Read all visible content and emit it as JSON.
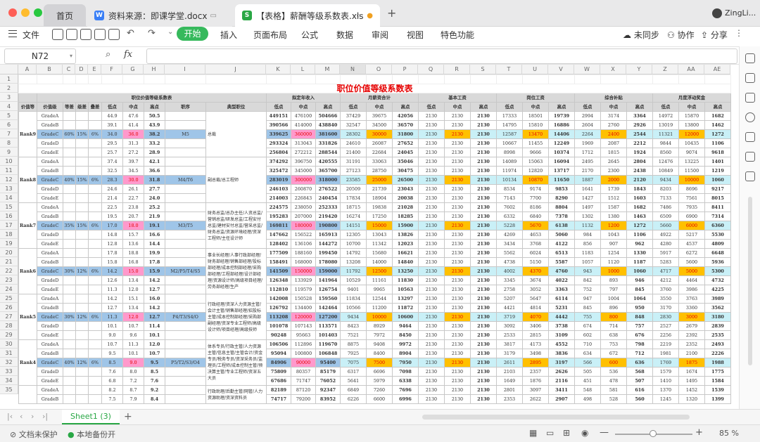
{
  "window": {
    "tabs": [
      {
        "label": "首页"
      },
      {
        "label": "资料来源：即课学堂.docx",
        "badge": "W"
      },
      {
        "label": "【表格】薪酬等级系数表.xls",
        "badge": "S"
      }
    ],
    "new_tab": "+",
    "user": "ZingLi..."
  },
  "menu": {
    "file": "文件",
    "start": "开始",
    "items": [
      "插入",
      "页面布局",
      "公式",
      "数据",
      "审阅",
      "视图",
      "特色功能"
    ],
    "sync": "未同步",
    "collab": "协作",
    "share": "分享"
  },
  "formula": {
    "cell_ref": "N72",
    "fx": "fx",
    "zoom_icon": "magnifier-icon",
    "value": ""
  },
  "sheet": {
    "columns": [
      "A",
      "B",
      "C",
      "D",
      "E",
      "F",
      "G",
      "H",
      "I",
      "J",
      "K",
      "L",
      "M",
      "N",
      "O",
      "P",
      "Q",
      "R",
      "S",
      "T",
      "U",
      "V",
      "W",
      "X",
      "Y",
      "Z",
      "AA",
      "AE"
    ],
    "row_numbers": [
      "1",
      "2",
      "3",
      "4",
      "5",
      "6",
      "7",
      "8",
      "9",
      "10",
      "11",
      "12",
      "13",
      "14",
      "15",
      "16",
      "17",
      "18",
      "19",
      "20",
      "21",
      "22",
      "23",
      "24",
      "25",
      "26",
      "27",
      "28",
      "29",
      "30",
      "31",
      "32",
      "33",
      "34",
      "35"
    ],
    "title": "职位价值等级系数表",
    "section_headers": [
      "职位价值等级系数表",
      "拟定年收入",
      "月薪资合计",
      "基本工资",
      "岗位工资",
      "综合补贴",
      "月度浮动奖金"
    ],
    "sub_headers": [
      "价值等",
      "价值级",
      "等差",
      "级差",
      "叠差",
      "低点",
      "中点",
      "高点",
      "职序",
      "典型职位",
      "低点",
      "中点",
      "高点",
      "低点",
      "中点",
      "高点",
      "低点",
      "中点",
      "高点",
      "低点",
      "中点",
      "高点",
      "低点",
      "中点",
      "高点",
      "低点",
      "中点",
      "高点"
    ],
    "rank_groups": [
      {
        "rank": "Rank9",
        "ratios": [
          "60%",
          "15%",
          "6%"
        ],
        "job": "M5",
        "typical": "总裁",
        "rows": [
          [
            "GradeA",
            "44.9",
            "47.6",
            "50.5",
            "449151",
            "476100",
            "504666",
            "37429",
            "39675",
            "42056",
            "2130",
            "2130",
            "2130",
            "17333",
            "18501",
            "19739",
            "2994",
            "3174",
            "3364",
            "14972",
            "15870",
            "1682"
          ],
          [
            "GradeB",
            "39.1",
            "41.4",
            "43.9",
            "390566",
            "414000",
            "438840",
            "32547",
            "34500",
            "36570",
            "2130",
            "2130",
            "2130",
            "14795",
            "15810",
            "16886",
            "2604",
            "2760",
            "2926",
            "13019",
            "13800",
            "1462"
          ],
          [
            "GradeC",
            "34.0",
            "36.0",
            "38.2",
            "339625",
            "360000",
            "381600",
            "28302",
            "30000",
            "31800",
            "2130",
            "2130",
            "2130",
            "12587",
            "13470",
            "14406",
            "2264",
            "2400",
            "2544",
            "11321",
            "12000",
            "1272"
          ],
          [
            "GradeD",
            "29.5",
            "31.3",
            "33.2",
            "293324",
            "313043",
            "331826",
            "24610",
            "26087",
            "27652",
            "2130",
            "2130",
            "2130",
            "10667",
            "11455",
            "12249",
            "1969",
            "2087",
            "2212",
            "9844",
            "10435",
            "1106"
          ],
          [
            "GradeE",
            "25.7",
            "27.2",
            "28.9",
            "256804",
            "272212",
            "288544",
            "21400",
            "22684",
            "24045",
            "2130",
            "2130",
            "2130",
            "8998",
            "9666",
            "10374",
            "1712",
            "1815",
            "1924",
            "8560",
            "9074",
            "9618"
          ]
        ]
      },
      {
        "rank": "Rank8",
        "ratios": [
          "40%",
          "15%",
          "6%"
        ],
        "job": "M4/T6",
        "typical": "副总裁/总工程师",
        "rows": [
          [
            "GradeA",
            "37.4",
            "39.7",
            "42.1",
            "374292",
            "396750",
            "420555",
            "31191",
            "33063",
            "35046",
            "2130",
            "2130",
            "2130",
            "14089",
            "15063",
            "16094",
            "2495",
            "2645",
            "2804",
            "12476",
            "13225",
            "1401"
          ],
          [
            "GradeB",
            "32.5",
            "34.5",
            "36.6",
            "325472",
            "345000",
            "365700",
            "27123",
            "28750",
            "30475",
            "2130",
            "2130",
            "2130",
            "11974",
            "12820",
            "13717",
            "2170",
            "2300",
            "2438",
            "10849",
            "11500",
            "1219"
          ],
          [
            "GradeC",
            "28.3",
            "30.0",
            "31.8",
            "283019",
            "300000",
            "318000",
            "23585",
            "25000",
            "26500",
            "2130",
            "2130",
            "2130",
            "10134",
            "10870",
            "11650",
            "1887",
            "2000",
            "2120",
            "9434",
            "10000",
            "1060"
          ],
          [
            "GradeD",
            "24.6",
            "26.1",
            "27.7",
            "246103",
            "260870",
            "276522",
            "20509",
            "21739",
            "23043",
            "2130",
            "2130",
            "2130",
            "8534",
            "9174",
            "9853",
            "1641",
            "1739",
            "1843",
            "8203",
            "8696",
            "9217"
          ],
          [
            "GradeE",
            "21.4",
            "22.7",
            "24.0",
            "214003",
            "226843",
            "240454",
            "17834",
            "18904",
            "20038",
            "2130",
            "2130",
            "2130",
            "7143",
            "7700",
            "8290",
            "1427",
            "1512",
            "1603",
            "7133",
            "7561",
            "8015"
          ]
        ]
      },
      {
        "rank": "Rank7",
        "ratios": [
          "35%",
          "15%",
          "6%"
        ],
        "job": "M3/T5",
        "typical": "财务总监/总办主任/人资总监/营销总监/研发总监/工程安付总监/建材安付总监/营采总监/财务总监/资源环境经理/资深工程师/主任设计师",
        "rows": [
          [
            "GradeA",
            "22.5",
            "23.8",
            "25.2",
            "224575",
            "238050",
            "252333",
            "18715",
            "19838",
            "21028",
            "2130",
            "2130",
            "2130",
            "7602",
            "8186",
            "8804",
            "1497",
            "1587",
            "1682",
            "7486",
            "7935",
            "8411"
          ],
          [
            "GradeB",
            "19.5",
            "20.7",
            "21.9",
            "195283",
            "207000",
            "219420",
            "16274",
            "17250",
            "18285",
            "2130",
            "2130",
            "2130",
            "6332",
            "6840",
            "7378",
            "1302",
            "1380",
            "1463",
            "6509",
            "6900",
            "7314"
          ],
          [
            "GradeC",
            "17.0",
            "18.0",
            "19.1",
            "169811",
            "180000",
            "190800",
            "14151",
            "15000",
            "15900",
            "2130",
            "2130",
            "2130",
            "5228",
            "5670",
            "6138",
            "1132",
            "1200",
            "1272",
            "5660",
            "6000",
            "6360"
          ],
          [
            "GradeD",
            "14.8",
            "15.7",
            "16.6",
            "147662",
            "156522",
            "165913",
            "12305",
            "13043",
            "13826",
            "2130",
            "2130",
            "2130",
            "4269",
            "4653",
            "5060",
            "984",
            "1043",
            "1106",
            "4922",
            "5217",
            "5530"
          ],
          [
            "GradeE",
            "12.8",
            "13.6",
            "14.4",
            "128402",
            "136106",
            "144272",
            "10700",
            "11342",
            "12023",
            "2130",
            "2130",
            "2130",
            "3434",
            "3768",
            "4122",
            "856",
            "907",
            "962",
            "4280",
            "4537",
            "4809"
          ]
        ]
      },
      {
        "rank": "Rank6",
        "ratios": [
          "30%",
          "12%",
          "6%"
        ],
        "job": "M2/P5/T4/S5",
        "typical": "事业长经理/人事行政部经理/财务部经理/销售部经理/投标部经理/成本控制部经理/采购部经理/工程部经理/设计部经理/资源设计师/高级项目经理/劳务部经理/生产",
        "rows": [
          [
            "GradeA",
            "17.8",
            "18.8",
            "19.9",
            "177509",
            "188160",
            "199450",
            "14792",
            "15680",
            "16621",
            "2130",
            "2130",
            "2130",
            "5562",
            "6024",
            "6513",
            "1183",
            "1254",
            "1330",
            "5917",
            "6272",
            "6648"
          ],
          [
            "GradeB",
            "15.8",
            "16.8",
            "17.8",
            "158491",
            "168000",
            "178080",
            "13208",
            "14000",
            "14840",
            "2130",
            "2130",
            "2130",
            "4738",
            "5150",
            "5587",
            "1057",
            "1120",
            "1187",
            "5283",
            "5600",
            "5936"
          ],
          [
            "GradeC",
            "14.2",
            "15.0",
            "15.9",
            "141509",
            "150000",
            "159000",
            "11792",
            "12500",
            "13250",
            "2130",
            "2130",
            "2130",
            "4002",
            "4370",
            "4760",
            "943",
            "1000",
            "1060",
            "4717",
            "5000",
            "5300"
          ],
          [
            "GradeD",
            "12.6",
            "13.4",
            "14.2",
            "126348",
            "133929",
            "141964",
            "10529",
            "11161",
            "11830",
            "2130",
            "2130",
            "2130",
            "3345",
            "3674",
            "4022",
            "842",
            "893",
            "946",
            "4212",
            "4464",
            "4732"
          ],
          [
            "GradeE",
            "11.3",
            "12.0",
            "12.7",
            "112810",
            "119579",
            "126754",
            "9401",
            "9965",
            "10563",
            "2130",
            "2130",
            "2130",
            "2758",
            "3052",
            "3363",
            "752",
            "797",
            "845",
            "3760",
            "3986",
            "4225"
          ]
        ]
      },
      {
        "rank": "Rank5",
        "ratios": [
          "30%",
          "12%",
          "6%"
        ],
        "job": "P4/T3/S4/O",
        "typical": "行政经理/资深人力资源主管/会计主管/销售部经理/招投标主管/成本控制部经理/采购部副经理/资深专业工程师/高级设计师/项目经理/高级技师",
        "rows": [
          [
            "GradeA",
            "14.2",
            "15.1",
            "16.0",
            "142008",
            "150528",
            "159560",
            "11834",
            "12544",
            "13297",
            "2130",
            "2130",
            "2130",
            "5207",
            "5647",
            "6114",
            "947",
            "1004",
            "1064",
            "3550",
            "3763",
            "3989"
          ],
          [
            "GradeB",
            "12.7",
            "13.4",
            "14.2",
            "126792",
            "134400",
            "142464",
            "10566",
            "11200",
            "11872",
            "2130",
            "2130",
            "2130",
            "4421",
            "4814",
            "5231",
            "845",
            "896",
            "950",
            "3170",
            "3360",
            "3562"
          ],
          [
            "GradeC",
            "11.3",
            "12.0",
            "12.7",
            "113208",
            "120000",
            "127200",
            "9434",
            "10000",
            "10600",
            "2130",
            "2130",
            "2130",
            "3719",
            "4070",
            "4442",
            "755",
            "800",
            "848",
            "2830",
            "3000",
            "3180"
          ],
          [
            "GradeD",
            "10.1",
            "10.7",
            "11.4",
            "101078",
            "107143",
            "113571",
            "8423",
            "8929",
            "9464",
            "2130",
            "2130",
            "2130",
            "3092",
            "3406",
            "3738",
            "674",
            "714",
            "757",
            "2527",
            "2679",
            "2839"
          ],
          [
            "GradeE",
            "9.0",
            "9.6",
            "10.1",
            "90248",
            "95663",
            "101403",
            "7521",
            "7972",
            "8450",
            "2130",
            "2130",
            "2130",
            "2533",
            "2815",
            "3109",
            "602",
            "638",
            "676",
            "2256",
            "2392",
            "2535"
          ]
        ]
      },
      {
        "rank": "Rank4",
        "ratios": [
          "40%",
          "12%",
          "6%"
        ],
        "job": "P5/T2/S3/O4",
        "typical": "体系专员/行政主管/人力资源主管/信息主管/主管会计/资金专员/税务专员/资深采务员/监理员/工程师/成本控制主管/预决算主管/专业工程师/资深五大员",
        "rows": [
          [
            "GradeA",
            "10.7",
            "11.3",
            "12.0",
            "106506",
            "112896",
            "119670",
            "8875",
            "9408",
            "9972",
            "2130",
            "2130",
            "2130",
            "3817",
            "4173",
            "4552",
            "710",
            "753",
            "798",
            "2219",
            "2352",
            "2493"
          ],
          [
            "GradeB",
            "9.5",
            "10.1",
            "10.7",
            "95094",
            "100800",
            "106848",
            "7925",
            "8400",
            "8904",
            "2130",
            "2130",
            "2130",
            "3179",
            "3498",
            "3836",
            "634",
            "672",
            "712",
            "1981",
            "2100",
            "2226"
          ],
          [
            "GradeC",
            "8.5",
            "9.0",
            "9.5",
            "84906",
            "90000",
            "95400",
            "7075",
            "7500",
            "7950",
            "2130",
            "2130",
            "2130",
            "2611",
            "2895",
            "3197",
            "566",
            "600",
            "636",
            "1769",
            "1875",
            "1988"
          ],
          [
            "GradeD",
            "7.6",
            "8.0",
            "8.5",
            "75809",
            "80357",
            "85179",
            "6317",
            "6696",
            "7098",
            "2130",
            "2130",
            "2130",
            "2103",
            "2357",
            "2626",
            "505",
            "536",
            "568",
            "1579",
            "1674",
            "1775"
          ],
          [
            "GradeE",
            "6.8",
            "7.2",
            "7.6",
            "67686",
            "71747",
            "76052",
            "5641",
            "5979",
            "6338",
            "2130",
            "2130",
            "2130",
            "1649",
            "1876",
            "2116",
            "451",
            "478",
            "507",
            "1410",
            "1495",
            "1584"
          ]
        ]
      },
      {
        "rank": "",
        "ratios": [
          "",
          "",
          ""
        ],
        "job": "",
        "typical": "行政助理/后勤主管/网管/人力资源助理/资深资料员",
        "rows": [
          [
            "GradeA",
            "8.2",
            "8.7",
            "9.2",
            "82189",
            "87120",
            "92347",
            "6849",
            "7260",
            "7696",
            "2130",
            "2130",
            "2130",
            "2801",
            "3097",
            "3411",
            "548",
            "581",
            "616",
            "1370",
            "1452",
            "1539"
          ],
          [
            "GradeB",
            "7.5",
            "7.9",
            "8.4",
            "74717",
            "79200",
            "83952",
            "6226",
            "6600",
            "6996",
            "2130",
            "2130",
            "2130",
            "2353",
            "2622",
            "2907",
            "498",
            "528",
            "560",
            "1245",
            "1320",
            "1399"
          ]
        ]
      }
    ],
    "tab_name": "Sheet1 (3)"
  },
  "status": {
    "protect": "文档未保护",
    "backup": "本地备份开",
    "zoom": "85 %",
    "zoom_value": 85
  }
}
